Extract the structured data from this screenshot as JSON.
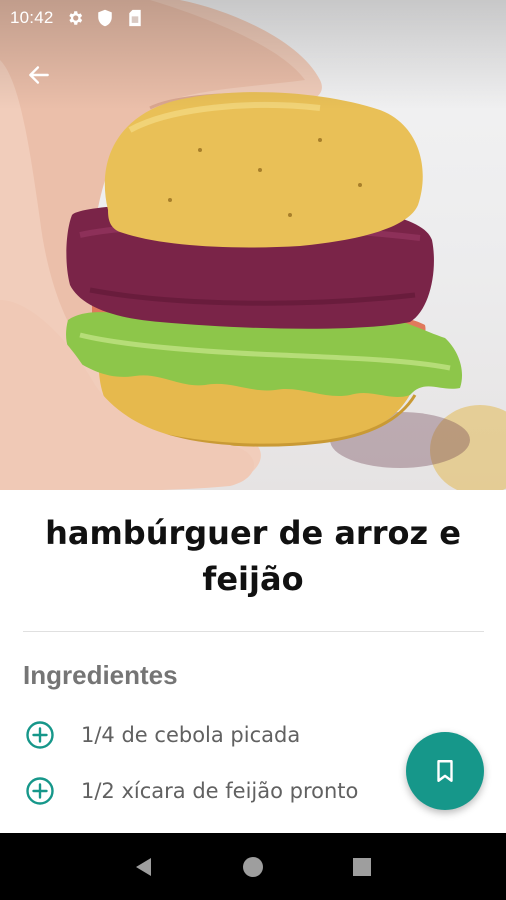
{
  "status_bar": {
    "time": "10:42",
    "icons": [
      "settings-icon",
      "shield-icon",
      "sim-card-icon"
    ]
  },
  "toolbar": {
    "back_icon": "arrow-left-icon"
  },
  "hero": {
    "image": "photo of hand holding a veggie burger with purple patty, lettuce and tomato in a yellow bun"
  },
  "recipe": {
    "title": "hambúrguer de arroz e feijão"
  },
  "ingredients": {
    "heading": "Ingredientes",
    "items": [
      "1/4 de cebola picada",
      "1/2 xícara de feijão pronto"
    ]
  },
  "fab": {
    "icon": "bookmark-icon"
  },
  "nav_bar": {
    "icons": [
      "back-triangle-icon",
      "home-circle-icon",
      "recents-square-icon"
    ]
  },
  "colors": {
    "accent": "#16978a",
    "title_text": "#111111",
    "heading_text": "#757575",
    "ingredient_text": "#616161"
  }
}
